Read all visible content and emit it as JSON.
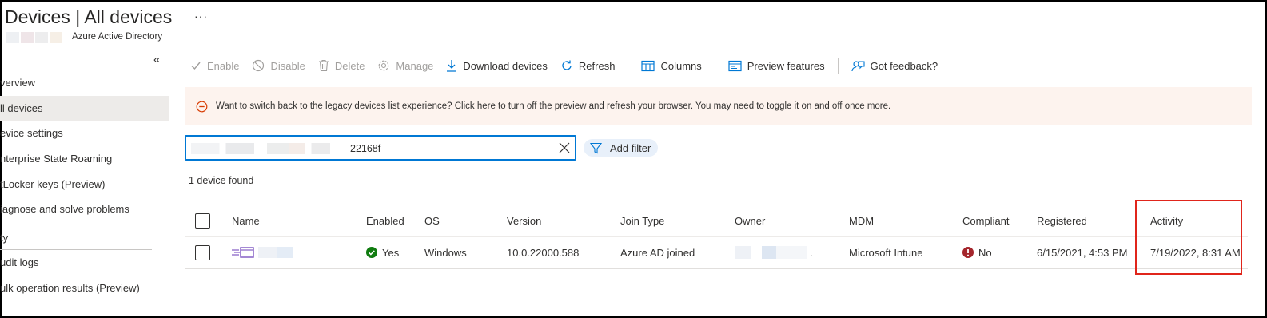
{
  "header": {
    "title_main": "Devices",
    "title_sep": " | ",
    "title_sub": "All devices",
    "more_label": "···",
    "subtitle": "Azure Active Directory",
    "collapse_glyph": "«"
  },
  "sidebar": {
    "items": [
      {
        "label": "verview",
        "active": false
      },
      {
        "label": "ll devices",
        "active": true
      },
      {
        "label": "evice settings",
        "active": false
      },
      {
        "label": "nterprise State Roaming",
        "active": false
      },
      {
        "label": "tLocker keys (Preview)",
        "active": false
      },
      {
        "label": "iagnose and solve problems",
        "active": false
      }
    ],
    "section_label": "ty",
    "section_items": [
      {
        "label": "udit logs"
      },
      {
        "label": "ulk operation results (Preview)"
      }
    ]
  },
  "toolbar": {
    "enable": "Enable",
    "disable": "Disable",
    "delete": "Delete",
    "manage": "Manage",
    "download": "Download devices",
    "refresh": "Refresh",
    "columns": "Columns",
    "preview_features": "Preview features",
    "feedback": "Got feedback?"
  },
  "banner": {
    "text": "Want to switch back to the legacy devices list experience? Click here to turn off the preview and refresh your browser. You may need to toggle it on and off once more."
  },
  "search": {
    "value_visible": "22168f",
    "clear_icon": "close-icon"
  },
  "filter": {
    "add_label": "Add filter"
  },
  "results": {
    "count_text": "1 device found"
  },
  "table": {
    "columns": [
      "Name",
      "Enabled",
      "OS",
      "Version",
      "Join Type",
      "Owner",
      "MDM",
      "Compliant",
      "Registered",
      "Activity"
    ],
    "rows": [
      {
        "name": "",
        "enabled": "Yes",
        "os": "Windows",
        "version": "10.0.22000.588",
        "join_type": "Azure AD joined",
        "owner": ".",
        "mdm": "Microsoft Intune",
        "compliant": "No",
        "registered": "6/15/2021, 4:53 PM",
        "activity": "7/19/2022, 8:31 AM"
      }
    ]
  },
  "colors": {
    "accent": "#0078d4",
    "success": "#107c10",
    "error": "#a4262c",
    "banner_bg": "#fdf3ee",
    "highlight": "#e0251b",
    "device_icon": "#8661c5"
  }
}
